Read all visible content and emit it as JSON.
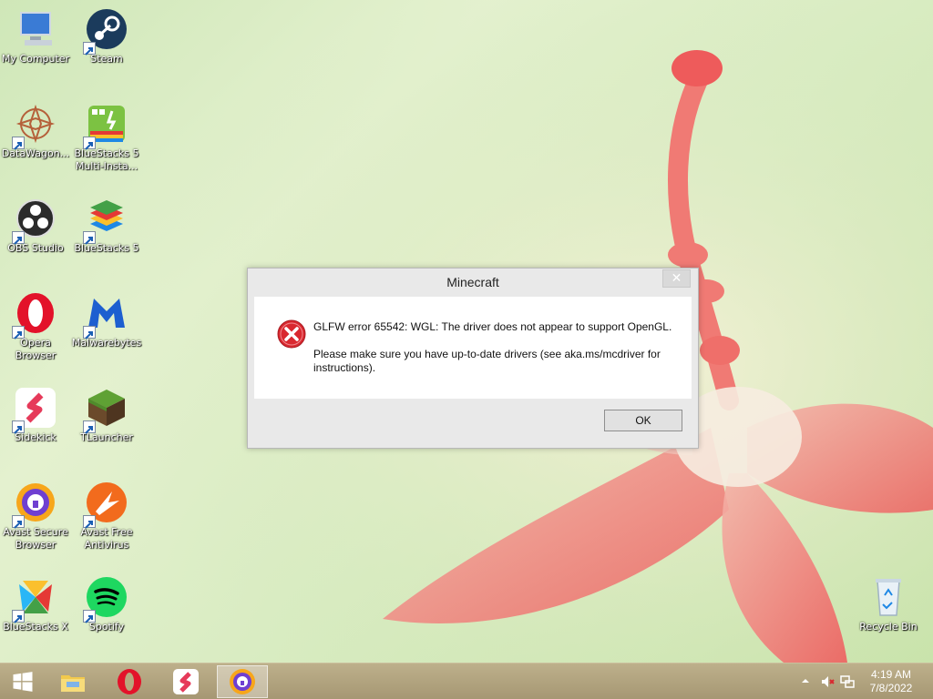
{
  "desktop_icons": [
    {
      "id": "my-computer",
      "label": "My Computer"
    },
    {
      "id": "steam",
      "label": "Steam"
    },
    {
      "id": "datawagon",
      "label": "DataWagon..."
    },
    {
      "id": "bluestacks5-multi",
      "label": "BlueStacks 5 Multi-Insta..."
    },
    {
      "id": "obs-studio",
      "label": "OBS Studio"
    },
    {
      "id": "bluestacks5",
      "label": "BlueStacks 5"
    },
    {
      "id": "opera-browser",
      "label": "Opera Browser"
    },
    {
      "id": "malwarebytes",
      "label": "Malwarebytes"
    },
    {
      "id": "sidekick",
      "label": "Sidekick"
    },
    {
      "id": "tlauncher",
      "label": "TLauncher"
    },
    {
      "id": "avast-secure-browser",
      "label": "Avast Secure Browser"
    },
    {
      "id": "avast-free-antivirus",
      "label": "Avast Free Antivirus"
    },
    {
      "id": "bluestacks-x",
      "label": "BlueStacks X"
    },
    {
      "id": "spotify",
      "label": "Spotify"
    },
    {
      "id": "recycle-bin",
      "label": "Recycle Bin"
    }
  ],
  "dialog": {
    "title": "Minecraft",
    "close_label": "✕",
    "message_line1": "GLFW error 65542: WGL: The driver does not appear to support OpenGL.",
    "message_line2": "Please make sure you have up-to-date drivers (see aka.ms/mcdriver for instructions).",
    "ok_label": "OK",
    "icon": "error-icon"
  },
  "taskbar": {
    "items": [
      "start-button",
      "file-explorer-icon",
      "opera-icon",
      "sidekick-icon",
      "avast-secure-browser-icon"
    ],
    "active_item": "avast-secure-browser-icon",
    "tray": [
      "show-hidden-icons",
      "volume-muted-icon",
      "network-icon"
    ],
    "time": "4:19 AM",
    "date": "7/8/2022"
  },
  "colors": {
    "wallpaper_green": "#d9ecc2",
    "flower_pink": "#f06a6a",
    "taskbar": "#b0a27d",
    "error_red": "#d9282f"
  }
}
